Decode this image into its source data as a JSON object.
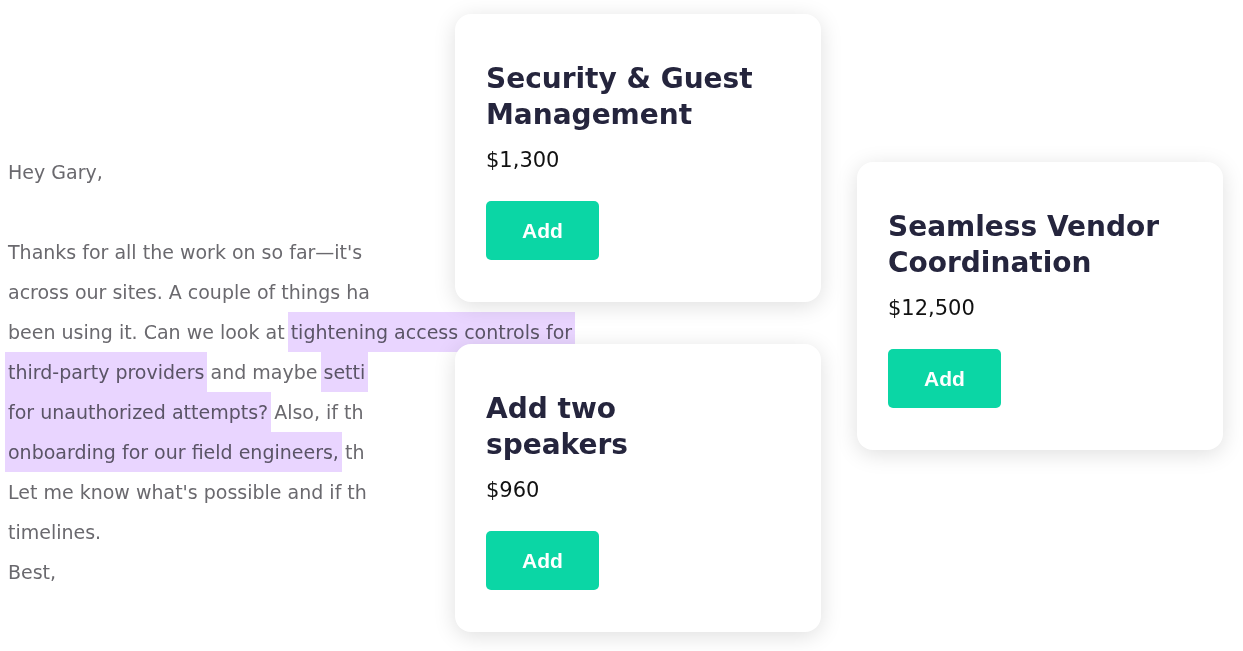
{
  "email": {
    "greeting": "Hey Gary,",
    "lines": [
      {
        "segments": [
          {
            "text": "Thanks for all the work on so far—it's",
            "highlighted": false
          }
        ]
      },
      {
        "segments": [
          {
            "text": "across our sites. A couple of things ha",
            "highlighted": false
          }
        ]
      },
      {
        "segments": [
          {
            "text": "been using it. Can we look at ",
            "highlighted": false
          },
          {
            "text": "tightening access controls for",
            "highlighted": true
          }
        ]
      },
      {
        "segments": [
          {
            "text": "third-party providers",
            "highlighted": true
          },
          {
            "text": " and maybe ",
            "highlighted": false
          },
          {
            "text": "setti",
            "highlighted": true
          }
        ]
      },
      {
        "segments": [
          {
            "text": "for unauthorized attempts?",
            "highlighted": true
          },
          {
            "text": " Also, if th",
            "highlighted": false
          }
        ]
      },
      {
        "segments": [
          {
            "text": "onboarding for our field engineers,",
            "highlighted": true
          },
          {
            "text": " th",
            "highlighted": false
          }
        ]
      },
      {
        "segments": [
          {
            "text": "Let me know what's possible and if th",
            "highlighted": false
          }
        ]
      },
      {
        "segments": [
          {
            "text": "timelines.",
            "highlighted": false
          }
        ]
      },
      {
        "segments": [
          {
            "text": "Best,",
            "highlighted": false
          }
        ]
      }
    ]
  },
  "cards": [
    {
      "title": "Security & Guest Management",
      "price": "$1,300",
      "button": "Add"
    },
    {
      "title": "Seamless Vendor Coordination",
      "price": "$12,500",
      "button": "Add"
    },
    {
      "title": "Add two speakers",
      "price": "$960",
      "button": "Add"
    }
  ]
}
